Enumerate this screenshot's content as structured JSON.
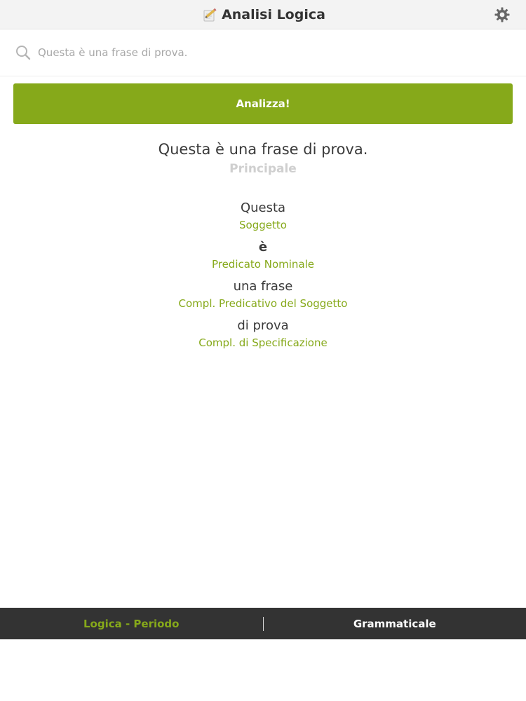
{
  "nav": {
    "title": "Analisi Logica",
    "logo_icon": "pencil-paper-icon",
    "settings_icon": "gear-icon"
  },
  "search": {
    "placeholder": "Questa è una frase di prova.",
    "value": "",
    "icon": "search-icon"
  },
  "analyze_button": {
    "label": "Analizza!"
  },
  "result": {
    "sentence": "Questa è una frase di prova.",
    "clause_type": "Principale",
    "components": [
      {
        "text": "Questa",
        "label": "Soggetto"
      },
      {
        "text": "è",
        "label": "Predicato Nominale"
      },
      {
        "text": "una frase",
        "label": "Compl. Predicativo del Soggetto"
      },
      {
        "text": "di prova",
        "label": "Compl. di Specificazione"
      }
    ]
  },
  "tabs": [
    {
      "label": "Logica - Periodo",
      "active": true
    },
    {
      "label": "Grammaticale",
      "active": false
    }
  ],
  "colors": {
    "accent": "#86a91a",
    "tabbar_bg": "#333333",
    "navbar_bg": "#f3f3f3"
  }
}
